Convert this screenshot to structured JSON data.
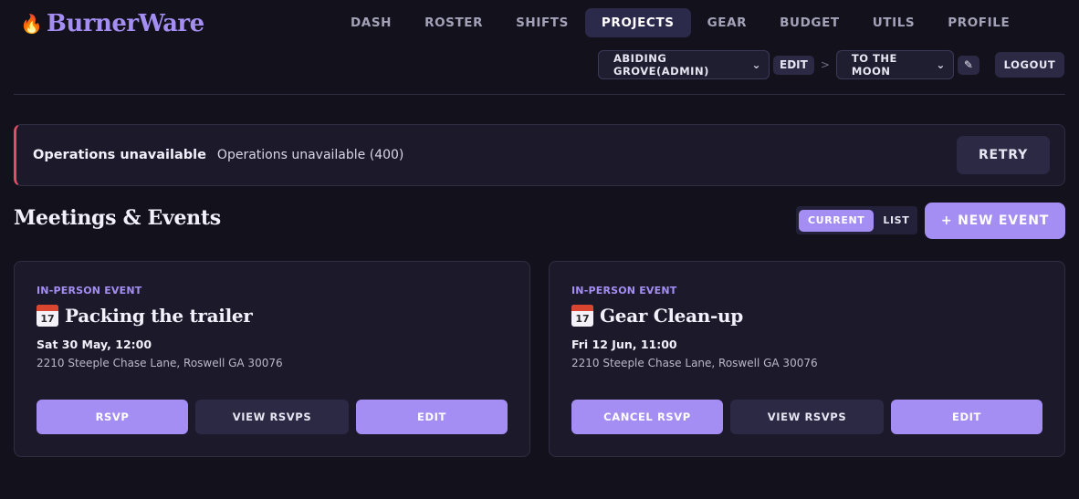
{
  "brand": {
    "flame_icon": "🔥",
    "name": "BurnerWare"
  },
  "nav": [
    {
      "label": "DASH",
      "active": false
    },
    {
      "label": "ROSTER",
      "active": false
    },
    {
      "label": "SHIFTS",
      "active": false
    },
    {
      "label": "PROJECTS",
      "active": true
    },
    {
      "label": "GEAR",
      "active": false
    },
    {
      "label": "BUDGET",
      "active": false
    },
    {
      "label": "UTILS",
      "active": false
    },
    {
      "label": "PROFILE",
      "active": false
    }
  ],
  "context": {
    "org_select": "ABIDING GROVE(ADMIN)",
    "edit_label": "EDIT",
    "separator": ">",
    "project_select": "TO THE MOON",
    "pencil_icon": "✎",
    "logout_label": "LOGOUT"
  },
  "alert": {
    "title": "Operations unavailable",
    "message": "Operations unavailable (400)",
    "retry_label": "RETRY"
  },
  "section": {
    "title": "Meetings & Events",
    "toggle": [
      {
        "label": "CURRENT",
        "active": true
      },
      {
        "label": "LIST",
        "active": false
      }
    ],
    "new_event_label": "+ NEW EVENT"
  },
  "events": [
    {
      "type": "IN-PERSON EVENT",
      "calendar_num": "17",
      "title": "Packing the trailer",
      "date": "Sat 30 May, 12:00",
      "address": "2210 Steeple Chase Lane, Roswell GA 30076",
      "actions": [
        "RSVP",
        "VIEW RSVPS",
        "EDIT"
      ]
    },
    {
      "type": "IN-PERSON EVENT",
      "calendar_num": "17",
      "title": "Gear Clean-up",
      "date": "Fri 12 Jun, 11:00",
      "address": "2210 Steeple Chase Lane, Roswell GA 30076",
      "actions": [
        "CANCEL RSVP",
        "VIEW RSVPS",
        "EDIT"
      ]
    }
  ],
  "colors": {
    "accent": "#a48ef4",
    "background": "#13121c",
    "alert_border": "#e04e6a"
  }
}
